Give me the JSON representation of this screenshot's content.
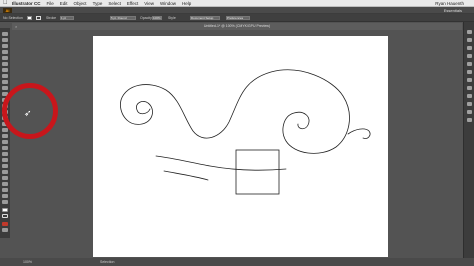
{
  "menubar": {
    "apple_icon": "apple-logo",
    "items": [
      "Illustrator CC",
      "File",
      "Edit",
      "Object",
      "Type",
      "Select",
      "Effect",
      "View",
      "Window",
      "Help"
    ],
    "user": "Ryan Hauenth"
  },
  "appbar": {
    "logo": "Ai",
    "workspace": "Essentials"
  },
  "controlbar": {
    "selection_label": "No Selection",
    "stroke_weight": "1 pt",
    "brush": "5 pt. Round",
    "opacity_label": "Opacity",
    "opacity": "100%",
    "style_label": "Style",
    "document_setup": "Document Setup",
    "preferences": "Preferences"
  },
  "document": {
    "tab_title": "Untitled-1* @ 100% (CMYK/GPU Preview)",
    "close_icon": "close-icon"
  },
  "status": {
    "zoom": "100%",
    "mode": "Selection"
  },
  "colors": {
    "menubar": "#e9e9e9",
    "workspace": "#535353",
    "panel": "#3c3c3c",
    "artboard": "#ffffff",
    "highlight_ring": "#c8161b",
    "stroke": "#222222"
  }
}
